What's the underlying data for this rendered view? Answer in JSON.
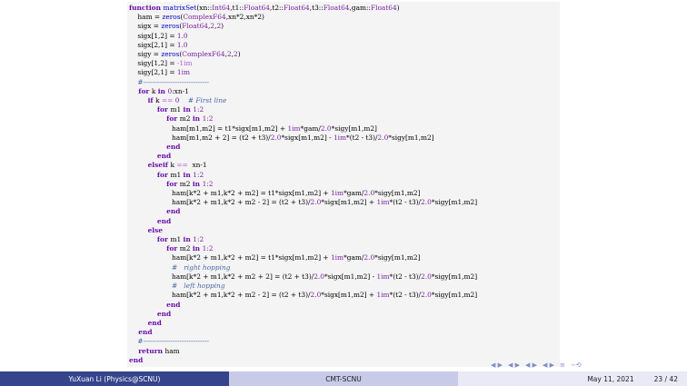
{
  "code": {
    "lines": [
      [
        [
          "kw",
          "function "
        ],
        [
          "fn",
          "matrixSet"
        ],
        [
          "",
          "(xn::"
        ],
        [
          "ty",
          "Int64"
        ],
        [
          "",
          ",t1::"
        ],
        [
          "ty",
          "Float64"
        ],
        [
          "",
          ",t2::"
        ],
        [
          "ty",
          "Float64"
        ],
        [
          "",
          ",t3::"
        ],
        [
          "ty",
          "Float64"
        ],
        [
          "",
          ",gam::"
        ],
        [
          "ty",
          "Float64"
        ],
        [
          "",
          ")"
        ]
      ],
      [
        [
          "",
          "    ham = "
        ],
        [
          "fn",
          "zeros"
        ],
        [
          "",
          "("
        ],
        [
          "ty",
          "ComplexF64"
        ],
        [
          "",
          ",xn*2,xn*2)"
        ]
      ],
      [
        [
          "",
          "    sigx = "
        ],
        [
          "fn",
          "zeros"
        ],
        [
          "",
          "("
        ],
        [
          "ty",
          "Float64"
        ],
        [
          "",
          ","
        ],
        [
          "num",
          "2"
        ],
        [
          "",
          ","
        ],
        [
          "num",
          "2"
        ],
        [
          "",
          ")"
        ]
      ],
      [
        [
          "",
          "    sigx[1,2] = "
        ],
        [
          "num",
          "1.0"
        ]
      ],
      [
        [
          "",
          "    sigx[2,1] = "
        ],
        [
          "num",
          "1.0"
        ]
      ],
      [
        [
          "",
          "    sigy = "
        ],
        [
          "fn",
          "zeros"
        ],
        [
          "",
          "("
        ],
        [
          "ty",
          "ComplexF64"
        ],
        [
          "",
          ","
        ],
        [
          "num",
          "2"
        ],
        [
          "",
          ","
        ],
        [
          "num",
          "2"
        ],
        [
          "",
          ")"
        ]
      ],
      [
        [
          "",
          "    sigy[1,2] = "
        ],
        [
          "op",
          "-1im"
        ]
      ],
      [
        [
          "",
          "    sigy[2,1] = "
        ],
        [
          "num",
          "1im"
        ]
      ],
      [
        [
          "cm",
          "    #-----------------------------"
        ]
      ],
      [
        [
          "kw",
          "    for "
        ],
        [
          "",
          "k "
        ],
        [
          "kw",
          "in "
        ],
        [
          "num",
          "0"
        ],
        [
          "",
          ":xn-1"
        ]
      ],
      [
        [
          "kw",
          "        if "
        ],
        [
          "",
          "k "
        ],
        [
          "op",
          "=="
        ],
        [
          "num",
          " 0"
        ],
        [
          "cm",
          "    # First line"
        ]
      ],
      [
        [
          "kw",
          "            for "
        ],
        [
          "",
          "m1 "
        ],
        [
          "kw",
          "in "
        ],
        [
          "num",
          "1:2"
        ]
      ],
      [
        [
          "kw",
          "                for "
        ],
        [
          "",
          "m2 "
        ],
        [
          "kw",
          "in "
        ],
        [
          "num",
          "1:2"
        ]
      ],
      [
        [
          "",
          "                    ham[m1,m2] = t1*sigx[m1,m2] + "
        ],
        [
          "num",
          "1im"
        ],
        [
          "",
          "*gam/"
        ],
        [
          "num",
          "2.0"
        ],
        [
          "",
          "*sigy[m1,m2]"
        ]
      ],
      [
        [
          "",
          "                    ham[m1,m2 + 2] = (t2 + t3)/"
        ],
        [
          "num",
          "2.0"
        ],
        [
          "",
          "*sigx[m1,m2] - "
        ],
        [
          "num",
          "1im"
        ],
        [
          "",
          "*(t2 - t3)/"
        ],
        [
          "num",
          "2.0"
        ],
        [
          "",
          "*sigy[m1,m2]"
        ]
      ],
      [
        [
          "kw",
          "                end"
        ]
      ],
      [
        [
          "kw",
          "            end"
        ]
      ],
      [
        [
          "kw",
          "        elseif "
        ],
        [
          "",
          "k "
        ],
        [
          "op",
          "=="
        ],
        [
          "",
          "  xn-1"
        ]
      ],
      [
        [
          "kw",
          "            for "
        ],
        [
          "",
          "m1 "
        ],
        [
          "kw",
          "in "
        ],
        [
          "num",
          "1:2"
        ]
      ],
      [
        [
          "kw",
          "                for "
        ],
        [
          "",
          "m2 "
        ],
        [
          "kw",
          "in "
        ],
        [
          "num",
          "1:2"
        ]
      ],
      [
        [
          "",
          "                    ham[k*2 + m1,k*2 + m2] = t1*sigx[m1,m2] + "
        ],
        [
          "num",
          "1im"
        ],
        [
          "",
          "*gam/"
        ],
        [
          "num",
          "2.0"
        ],
        [
          "",
          "*sigy[m1,m2]"
        ]
      ],
      [
        [
          "",
          "                    ham[k*2 + m1,k*2 + m2 - 2] = (t2 + t3)/"
        ],
        [
          "num",
          "2.0"
        ],
        [
          "",
          "*sigx[m1,m2] + "
        ],
        [
          "num",
          "1im"
        ],
        [
          "",
          "*(t2 - t3)/"
        ],
        [
          "num",
          "2.0"
        ],
        [
          "",
          "*sigy[m1,m2]"
        ]
      ],
      [
        [
          "kw",
          "                end"
        ]
      ],
      [
        [
          "kw",
          "            end"
        ]
      ],
      [
        [
          "kw",
          "        else"
        ]
      ],
      [
        [
          "kw",
          "            for "
        ],
        [
          "",
          "m1 "
        ],
        [
          "kw",
          "in "
        ],
        [
          "num",
          "1:2"
        ]
      ],
      [
        [
          "kw",
          "                for "
        ],
        [
          "",
          "m2 "
        ],
        [
          "kw",
          "in "
        ],
        [
          "num",
          "1:2"
        ]
      ],
      [
        [
          "",
          "                    ham[k*2 + m1,k*2 + m2] = t1*sigx[m1,m2] + "
        ],
        [
          "num",
          "1im"
        ],
        [
          "",
          "*gam/"
        ],
        [
          "num",
          "2.0"
        ],
        [
          "",
          "*sigy[m1,m2]"
        ]
      ],
      [
        [
          "cm",
          "                    #   right hopping"
        ]
      ],
      [
        [
          "",
          "                    ham[k*2 + m1,k*2 + m2 + 2] = (t2 + t3)/"
        ],
        [
          "num",
          "2.0"
        ],
        [
          "",
          "*sigx[m1,m2] - "
        ],
        [
          "num",
          "1im"
        ],
        [
          "",
          "*(t2 - t3)/"
        ],
        [
          "num",
          "2.0"
        ],
        [
          "",
          "*sigy[m1,m2]"
        ]
      ],
      [
        [
          "cm",
          "                    #   left hopping"
        ]
      ],
      [
        [
          "",
          "                    ham[k*2 + m1,k*2 + m2 - 2] = (t2 + t3)/"
        ],
        [
          "num",
          "2.0"
        ],
        [
          "",
          "*sigx[m1,m2] + "
        ],
        [
          "num",
          "1im"
        ],
        [
          "",
          "*(t2 - t3)/"
        ],
        [
          "num",
          "2.0"
        ],
        [
          "",
          "*sigy[m1,m2]"
        ]
      ],
      [
        [
          "kw",
          "                end"
        ]
      ],
      [
        [
          "kw",
          "            end"
        ]
      ],
      [
        [
          "kw",
          "        end"
        ]
      ],
      [
        [
          "kw",
          "    end"
        ]
      ],
      [
        [
          "cm",
          "    #-----------------------------"
        ]
      ],
      [
        [
          "kw",
          "    return "
        ],
        [
          "",
          "ham"
        ]
      ],
      [
        [
          "kw",
          "end"
        ]
      ]
    ]
  },
  "nav": {
    "icons": [
      "nav-left-icon",
      "nav-right-icon",
      "nav-section-icon",
      "nav-subsection-icon",
      "nav-frame-icon",
      "nav-search-icon"
    ],
    "glyphs": [
      "◀ ▶",
      "◀ ▶",
      "◀ ▶",
      "◀ ▶",
      "≡",
      "∽⟲"
    ]
  },
  "footer": {
    "author": "YuXuan Li  (Physics@SCNU)",
    "institute": "CMT-SCNU",
    "date": "May 11, 2021",
    "page": "23 / 42"
  },
  "colors": {
    "footer_dark": "#36448c",
    "footer_mid": "#c8cbe8",
    "footer_light": "#e9eaf6",
    "code_bg": "#f4f4f4"
  }
}
